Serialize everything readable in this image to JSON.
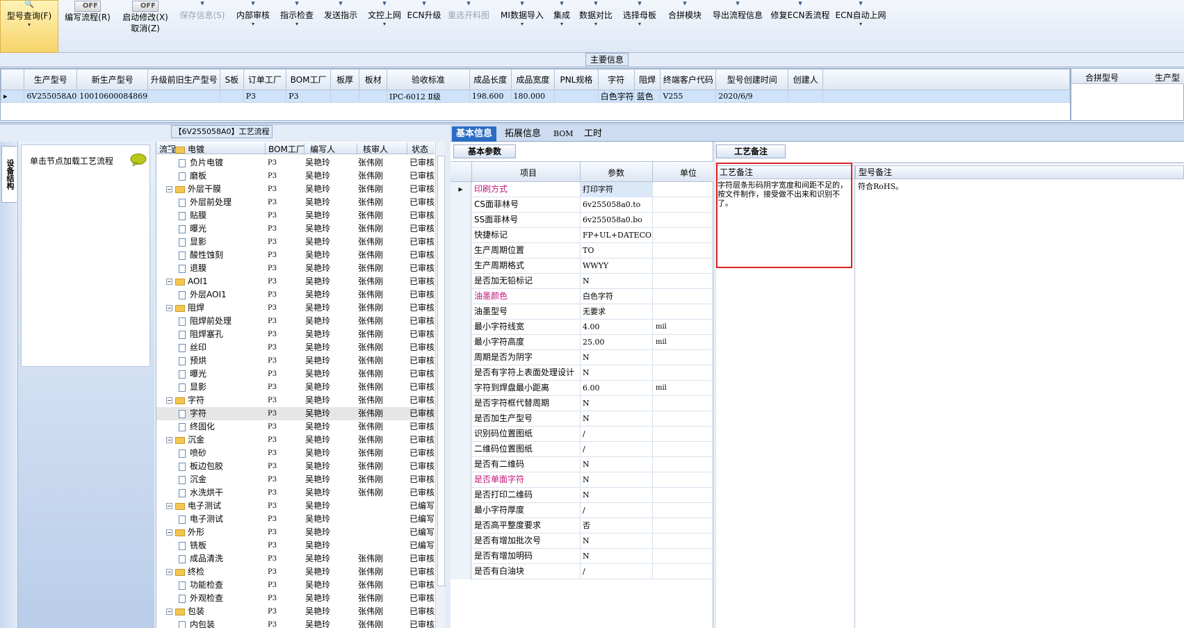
{
  "toolbar": {
    "items": [
      {
        "label": "型号查询(F)",
        "drop": "▾"
      },
      {
        "label": "编写流程(R)",
        "toggle": "OFF"
      },
      {
        "label": "启动修改(X)",
        "label2": "取消(Z)",
        "toggle": "OFF"
      },
      {
        "label": "保存信息(S)"
      },
      {
        "label": "内部审核",
        "drop": "▾"
      },
      {
        "label": "指示检查",
        "drop": "▾"
      },
      {
        "label": "发送指示"
      },
      {
        "label": "文控上网",
        "drop": "▾"
      },
      {
        "label": "ECN升级"
      },
      {
        "label": "重选开料图"
      },
      {
        "label": "MI数据导入",
        "drop": "▾"
      },
      {
        "label": "集成",
        "drop": "▾"
      },
      {
        "label": "数据对比",
        "drop": "▾"
      },
      {
        "label": "选择母板",
        "drop": "▾"
      },
      {
        "label": "合拼模块"
      },
      {
        "label": "导出流程信息"
      },
      {
        "label": "修复ECN丢流程"
      },
      {
        "label": "ECN自动上网",
        "drop": "▾"
      }
    ]
  },
  "maininfo": {
    "caption": "主要信息",
    "columns": [
      "生产型号",
      "新生产型号",
      "升级前旧生产型号",
      "S板",
      "订单工厂",
      "BOM工厂",
      "板厚",
      "板材",
      "验收标准",
      "成品长度",
      "成品宽度",
      "PNL规格",
      "字符",
      "阻焊",
      "终端客户代码",
      "型号创建时间",
      "创建人"
    ],
    "row": [
      "6V255058A0",
      "10010600084869",
      "",
      "",
      "P3",
      "P3",
      "",
      "",
      "IPC-6012 Ⅱ级",
      "198.600",
      "180.000",
      "",
      "白色字符",
      "蓝色",
      "V255",
      "2020/6/9",
      ""
    ],
    "right_columns": [
      "合拼型号",
      "生产型"
    ]
  },
  "flow": {
    "caption": "【6V255058A0】工艺流程",
    "side_tab": "设备结构",
    "hint": "单击节点加载工艺流程",
    "columns": [
      "流程",
      "BOM工厂",
      "编写人",
      "核审人",
      "状态"
    ],
    "rows": [
      {
        "name": "电镀",
        "level": 0,
        "bom": "",
        "writer": "",
        "checker": "",
        "status": ""
      },
      {
        "name": "负片电镀",
        "level": 1,
        "bom": "P3",
        "writer": "吴艳玲",
        "checker": "张伟刚",
        "status": "已审核"
      },
      {
        "name": "磨板",
        "level": 1,
        "bom": "P3",
        "writer": "吴艳玲",
        "checker": "张伟刚",
        "status": "已审核"
      },
      {
        "name": "外层干膜",
        "level": 0,
        "bom": "P3",
        "writer": "吴艳玲",
        "checker": "张伟刚",
        "status": "已审核"
      },
      {
        "name": "外层前处理",
        "level": 1,
        "bom": "P3",
        "writer": "吴艳玲",
        "checker": "张伟刚",
        "status": "已审核"
      },
      {
        "name": "贴膜",
        "level": 1,
        "bom": "P3",
        "writer": "吴艳玲",
        "checker": "张伟刚",
        "status": "已审核"
      },
      {
        "name": "曝光",
        "level": 1,
        "bom": "P3",
        "writer": "吴艳玲",
        "checker": "张伟刚",
        "status": "已审核"
      },
      {
        "name": "显影",
        "level": 1,
        "bom": "P3",
        "writer": "吴艳玲",
        "checker": "张伟刚",
        "status": "已审核"
      },
      {
        "name": "酸性蚀刻",
        "level": 1,
        "bom": "P3",
        "writer": "吴艳玲",
        "checker": "张伟刚",
        "status": "已审核"
      },
      {
        "name": "退膜",
        "level": 1,
        "bom": "P3",
        "writer": "吴艳玲",
        "checker": "张伟刚",
        "status": "已审核"
      },
      {
        "name": "AOI1",
        "level": 0,
        "bom": "P3",
        "writer": "吴艳玲",
        "checker": "张伟刚",
        "status": "已审核"
      },
      {
        "name": "外层AOI1",
        "level": 1,
        "bom": "P3",
        "writer": "吴艳玲",
        "checker": "张伟刚",
        "status": "已审核"
      },
      {
        "name": "阻焊",
        "level": 0,
        "bom": "P3",
        "writer": "吴艳玲",
        "checker": "张伟刚",
        "status": "已审核"
      },
      {
        "name": "阻焊前处理",
        "level": 1,
        "bom": "P3",
        "writer": "吴艳玲",
        "checker": "张伟刚",
        "status": "已审核"
      },
      {
        "name": "阻焊塞孔",
        "level": 1,
        "bom": "P3",
        "writer": "吴艳玲",
        "checker": "张伟刚",
        "status": "已审核"
      },
      {
        "name": "丝印",
        "level": 1,
        "bom": "P3",
        "writer": "吴艳玲",
        "checker": "张伟刚",
        "status": "已审核"
      },
      {
        "name": "预烘",
        "level": 1,
        "bom": "P3",
        "writer": "吴艳玲",
        "checker": "张伟刚",
        "status": "已审核"
      },
      {
        "name": "曝光",
        "level": 1,
        "bom": "P3",
        "writer": "吴艳玲",
        "checker": "张伟刚",
        "status": "已审核"
      },
      {
        "name": "显影",
        "level": 1,
        "bom": "P3",
        "writer": "吴艳玲",
        "checker": "张伟刚",
        "status": "已审核"
      },
      {
        "name": "字符",
        "level": 0,
        "bom": "P3",
        "writer": "吴艳玲",
        "checker": "张伟刚",
        "status": "已审核"
      },
      {
        "name": "字符",
        "level": 1,
        "bom": "P3",
        "writer": "吴艳玲",
        "checker": "张伟刚",
        "status": "已审核",
        "selected": true
      },
      {
        "name": "终固化",
        "level": 1,
        "bom": "P3",
        "writer": "吴艳玲",
        "checker": "张伟刚",
        "status": "已审核"
      },
      {
        "name": "沉金",
        "level": 0,
        "bom": "P3",
        "writer": "吴艳玲",
        "checker": "张伟刚",
        "status": "已审核"
      },
      {
        "name": "喷砂",
        "level": 1,
        "bom": "P3",
        "writer": "吴艳玲",
        "checker": "张伟刚",
        "status": "已审核"
      },
      {
        "name": "板边包胶",
        "level": 1,
        "bom": "P3",
        "writer": "吴艳玲",
        "checker": "张伟刚",
        "status": "已审核"
      },
      {
        "name": "沉金",
        "level": 1,
        "bom": "P3",
        "writer": "吴艳玲",
        "checker": "张伟刚",
        "status": "已审核"
      },
      {
        "name": "水洗烘干",
        "level": 1,
        "bom": "P3",
        "writer": "吴艳玲",
        "checker": "张伟刚",
        "status": "已审核"
      },
      {
        "name": "电子测试",
        "level": 0,
        "bom": "P3",
        "writer": "吴艳玲",
        "checker": "",
        "status": "已编写"
      },
      {
        "name": "电子测试",
        "level": 1,
        "bom": "P3",
        "writer": "吴艳玲",
        "checker": "",
        "status": "已编写"
      },
      {
        "name": "外形",
        "level": 0,
        "bom": "P3",
        "writer": "吴艳玲",
        "checker": "",
        "status": "已编写"
      },
      {
        "name": "铣板",
        "level": 1,
        "bom": "P3",
        "writer": "吴艳玲",
        "checker": "",
        "status": "已编写"
      },
      {
        "name": "成品清洗",
        "level": 1,
        "bom": "P3",
        "writer": "吴艳玲",
        "checker": "张伟刚",
        "status": "已审核"
      },
      {
        "name": "终检",
        "level": 0,
        "bom": "P3",
        "writer": "吴艳玲",
        "checker": "张伟刚",
        "status": "已审核"
      },
      {
        "name": "功能检查",
        "level": 1,
        "bom": "P3",
        "writer": "吴艳玲",
        "checker": "张伟刚",
        "status": "已审核"
      },
      {
        "name": "外观检查",
        "level": 1,
        "bom": "P3",
        "writer": "吴艳玲",
        "checker": "张伟刚",
        "status": "已审核"
      },
      {
        "name": "包装",
        "level": 0,
        "bom": "P3",
        "writer": "吴艳玲",
        "checker": "张伟刚",
        "status": "已审核"
      },
      {
        "name": "内包装",
        "level": 1,
        "bom": "P3",
        "writer": "吴艳玲",
        "checker": "张伟刚",
        "status": "已审核"
      }
    ]
  },
  "tabs": [
    "基本信息",
    "拓展信息",
    "BOM",
    "工时"
  ],
  "params": {
    "section": "基本参数",
    "columns": [
      "项目",
      "参数",
      "单位"
    ],
    "rows": [
      {
        "item": "印刷方式",
        "value": "打印字符",
        "unit": "",
        "pink": true
      },
      {
        "item": "CS面菲林号",
        "value": "6v255058a0.to",
        "unit": ""
      },
      {
        "item": "SS面菲林号",
        "value": "6v255058a0.bo",
        "unit": ""
      },
      {
        "item": "快捷标记",
        "value": "FP+UL+DATECODE",
        "unit": ""
      },
      {
        "item": "生产周期位置",
        "value": "TO",
        "unit": ""
      },
      {
        "item": "生产周期格式",
        "value": "WWYY",
        "unit": ""
      },
      {
        "item": "是否加无铅标记",
        "value": "N",
        "unit": ""
      },
      {
        "item": "油墨颜色",
        "value": "白色字符",
        "unit": "",
        "pink": true
      },
      {
        "item": "油墨型号",
        "value": "无要求",
        "unit": ""
      },
      {
        "item": "最小字符线宽",
        "value": "4.00",
        "unit": "mil"
      },
      {
        "item": "最小字符高度",
        "value": "25.00",
        "unit": "mil"
      },
      {
        "item": "周期是否为阴字",
        "value": "N",
        "unit": ""
      },
      {
        "item": "是否有字符上表面处理设计",
        "value": "N",
        "unit": ""
      },
      {
        "item": "字符到焊盘最小距离",
        "value": "6.00",
        "unit": "mil"
      },
      {
        "item": "是否字符框代替周期",
        "value": "N",
        "unit": ""
      },
      {
        "item": "是否加生产型号",
        "value": "N",
        "unit": ""
      },
      {
        "item": "识别码位置图纸",
        "value": "/",
        "unit": ""
      },
      {
        "item": "二维码位置图纸",
        "value": "/",
        "unit": ""
      },
      {
        "item": "是否有二维码",
        "value": "N",
        "unit": ""
      },
      {
        "item": "是否单面字符",
        "value": "N",
        "unit": "",
        "pink": true
      },
      {
        "item": "是否打印二维码",
        "value": "N",
        "unit": ""
      },
      {
        "item": "最小字符厚度",
        "value": "/",
        "unit": ""
      },
      {
        "item": "是否高平整度要求",
        "value": "否",
        "unit": ""
      },
      {
        "item": "是否有增加批次号",
        "value": "N",
        "unit": ""
      },
      {
        "item": "是否有增加明码",
        "value": "N",
        "unit": ""
      },
      {
        "item": "是否有白油块",
        "value": "/",
        "unit": ""
      }
    ]
  },
  "remarks": {
    "section": "工艺备注",
    "process_label": "工艺备注",
    "process_text": "字符层条形码阴字宽度和间距不足的，按文件制作，接受做不出来和识别不了。",
    "model_label": "型号备注",
    "model_text": "符合RoHS。"
  },
  "colors": {
    "highlight_box": "#e02020",
    "tab_active": "#2b6cc4",
    "pink": "#c0157a"
  }
}
